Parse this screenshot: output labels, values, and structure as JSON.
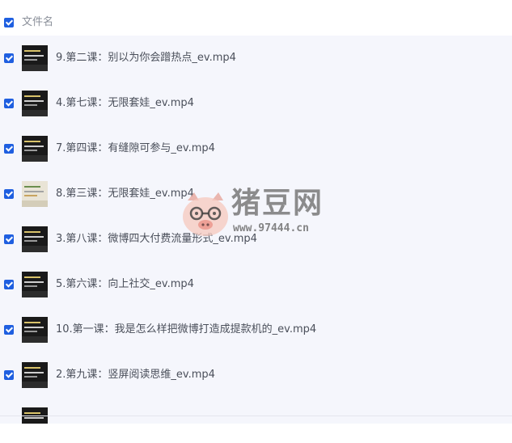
{
  "header": {
    "column_label": "文件名",
    "checked": true
  },
  "files": [
    {
      "name": "9.第二课：别以为你会蹭热点_ev.mp4",
      "checked": true,
      "thumb": "dark"
    },
    {
      "name": "4.第七课：无限套娃_ev.mp4",
      "checked": true,
      "thumb": "dark"
    },
    {
      "name": "7.第四课：有缝隙可参与_ev.mp4",
      "checked": true,
      "thumb": "dark"
    },
    {
      "name": "8.第三课：无限套娃_ev.mp4",
      "checked": true,
      "thumb": "light"
    },
    {
      "name": "3.第八课：微博四大付费流量形式_ev.mp4",
      "checked": true,
      "thumb": "dark"
    },
    {
      "name": "5.第六课：向上社交_ev.mp4",
      "checked": true,
      "thumb": "dark"
    },
    {
      "name": "10.第一课：我是怎么样把微博打造成提款机的_ev.mp4",
      "checked": true,
      "thumb": "dark"
    },
    {
      "name": "2.第九课：竖屏阅读思维_ev.mp4",
      "checked": true,
      "thumb": "dark"
    }
  ],
  "watermark": {
    "title": "猪豆网",
    "url": "www.97444.cn"
  },
  "colors": {
    "checkbox": "#1f5fe0",
    "list_background": "#f5f6fc",
    "text": "#4a4f5a",
    "header_text": "#8a8f99"
  }
}
